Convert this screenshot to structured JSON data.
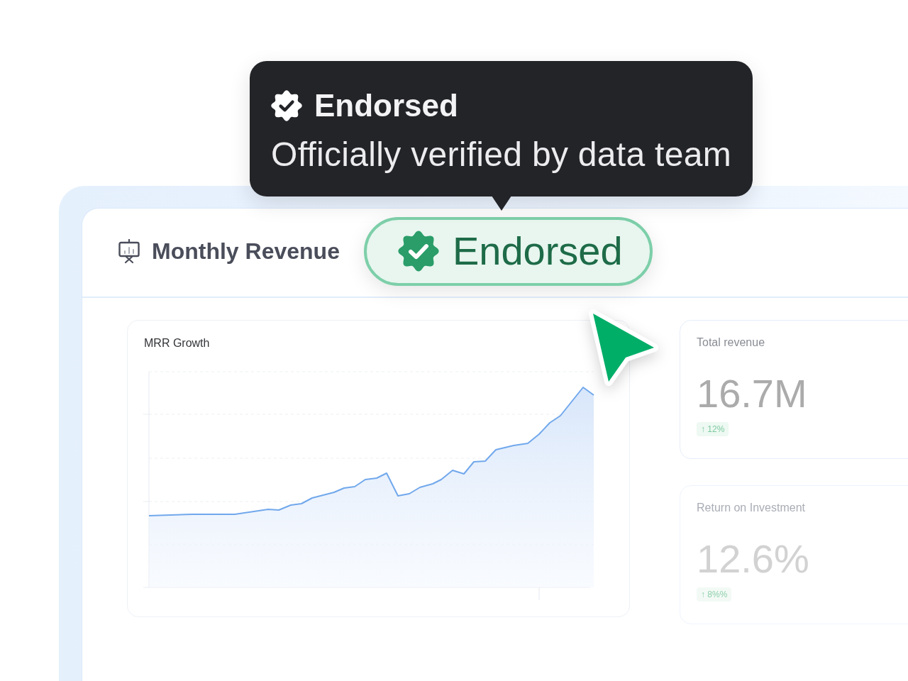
{
  "tooltip": {
    "title": "Endorsed",
    "description": "Officially verified by data team"
  },
  "header": {
    "title": "Monthly Revenue",
    "status_pill": {
      "label": "Endorsed"
    }
  },
  "chart_card": {
    "title": "MRR Growth"
  },
  "stat_cards": [
    {
      "title": "Total revenue",
      "value": "16.7M",
      "change": "↑ 12%"
    },
    {
      "title": "Return on Investment",
      "value": "12.6%",
      "change": "↑ 8%%"
    }
  ]
}
